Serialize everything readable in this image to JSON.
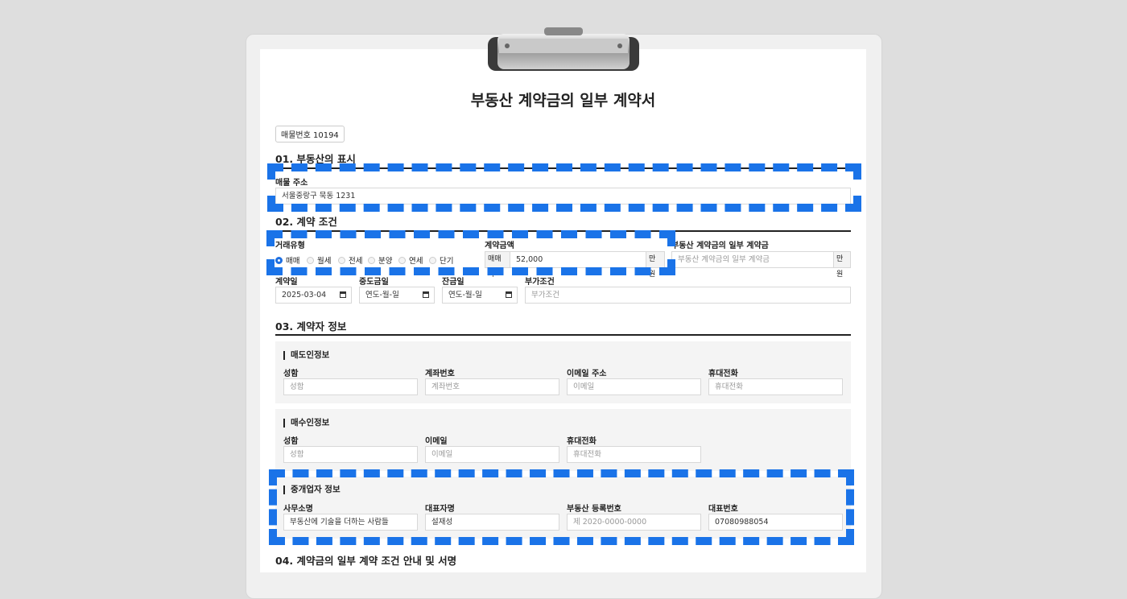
{
  "doc_title": "부동산 계약금의 일부 계약서",
  "listing_badge": "매물번호 10194",
  "sections": {
    "s1": "01. 부동산의 표시",
    "s2": "02. 계약 조건",
    "s3": "03. 계약자 정보",
    "s4": "04. 계약금의 일부 계약 조건 안내 및 서명"
  },
  "property": {
    "address_label": "매물 주소",
    "address_value": "서울중랑구 묵동 1231"
  },
  "terms": {
    "deal_type_label": "거래유형",
    "deal_types": [
      "매매",
      "월세",
      "전세",
      "분양",
      "연세",
      "단기"
    ],
    "selected_deal_type": "매매",
    "amount_label": "계약금액",
    "amount_prefix": "매매가",
    "amount_value": "52,000",
    "amount_unit": "만원",
    "partial_label": "부동산 계약금의 일부 계약금",
    "partial_placeholder": "부동산 계약금의 일부 계약금",
    "partial_unit": "만원",
    "contract_date_label": "계약일",
    "contract_date_value": "2025-03-04",
    "middle_date_label": "중도금일",
    "middle_date_placeholder": "연도-월-일",
    "balance_date_label": "잔금일",
    "balance_date_placeholder": "연도-월-일",
    "extra_label": "부가조건",
    "extra_placeholder": "부가조건"
  },
  "seller": {
    "title": "매도인정보",
    "name_label": "성함",
    "name_ph": "성함",
    "account_label": "계좌번호",
    "account_ph": "계좌번호",
    "email_label": "이메일 주소",
    "email_ph": "이메일",
    "phone_label": "휴대전화",
    "phone_ph": "휴대전화"
  },
  "buyer": {
    "title": "매수인정보",
    "name_label": "성함",
    "name_ph": "성함",
    "email_label": "이메일",
    "email_ph": "이메일",
    "phone_label": "휴대전화",
    "phone_ph": "휴대전화"
  },
  "broker": {
    "title": "중개업자 정보",
    "office_label": "사무소명",
    "office_value": "부동산에 기술을 더하는 사람들",
    "rep_label": "대표자명",
    "rep_value": "설재성",
    "reg_label": "부동산 등록번호",
    "reg_ph": "제 2020-0000-0000",
    "tel_label": "대표번호",
    "tel_value": "07080988054"
  },
  "colors": {
    "accent": "#1a73e8",
    "radio": "#1e6fe0"
  }
}
